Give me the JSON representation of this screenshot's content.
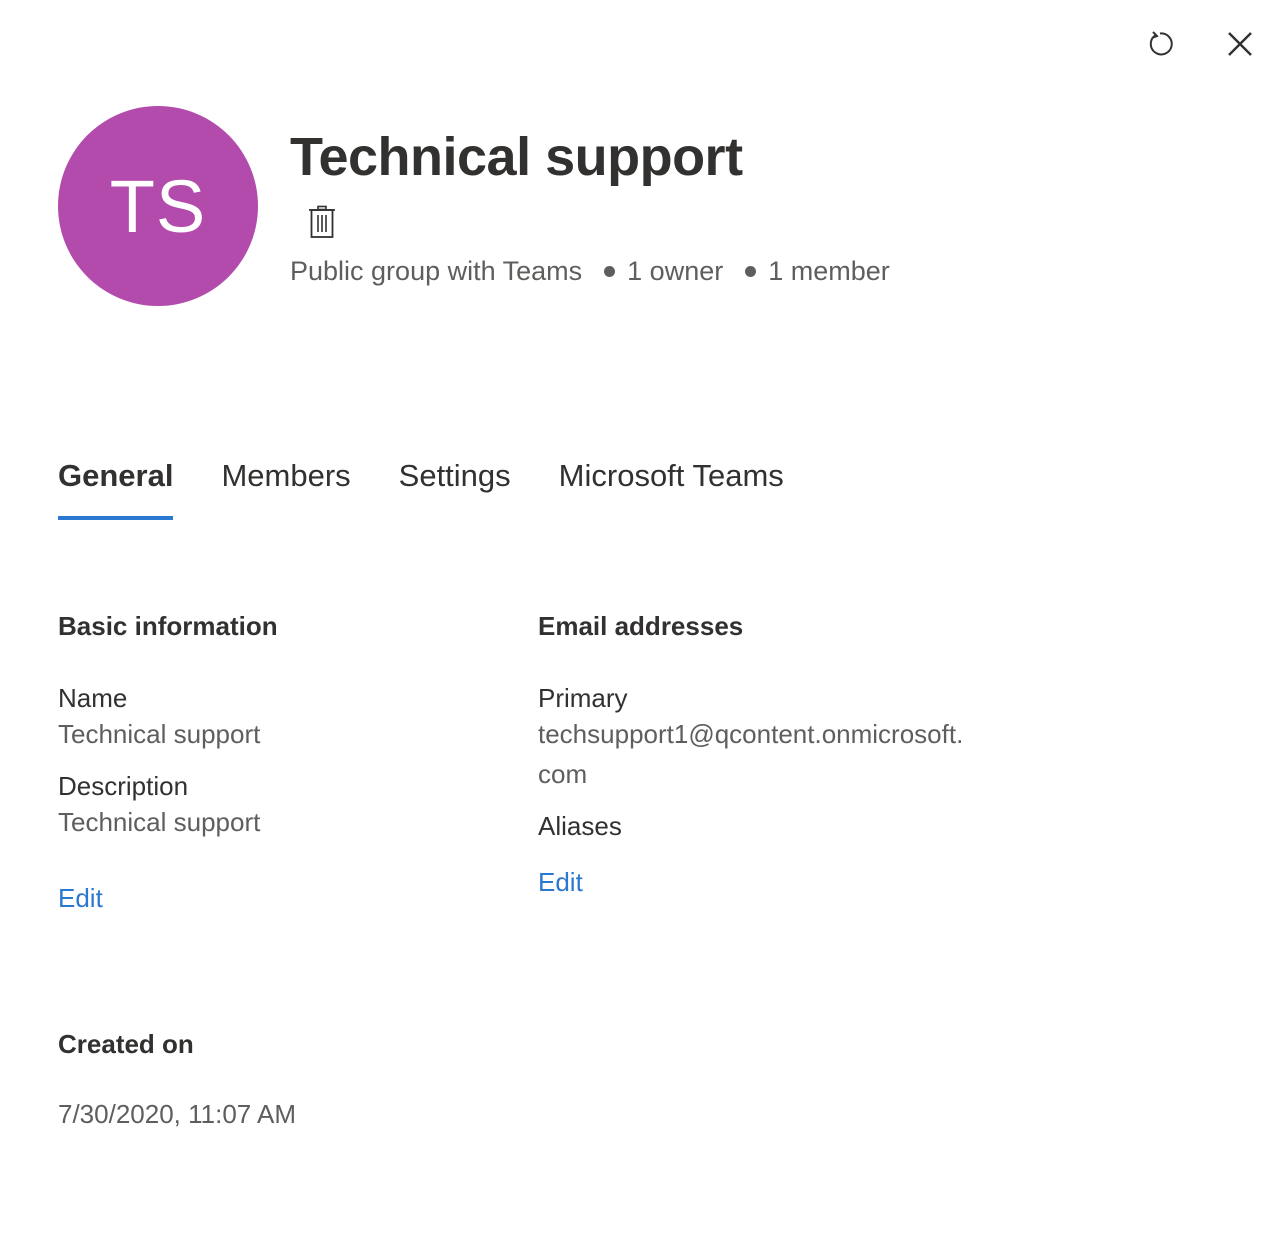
{
  "panel": {
    "refresh_label": "Refresh",
    "close_label": "Close"
  },
  "group": {
    "initials": "TS",
    "avatar_color": "#b34bac",
    "title": "Technical support",
    "delete_label": "Delete group",
    "type": "Public group with Teams",
    "owners": "1 owner",
    "members": "1 member"
  },
  "tabs": [
    {
      "label": "General",
      "active": true
    },
    {
      "label": "Members",
      "active": false
    },
    {
      "label": "Settings",
      "active": false
    },
    {
      "label": "Microsoft Teams",
      "active": false
    }
  ],
  "basic_info": {
    "title": "Basic information",
    "name_label": "Name",
    "name_value": "Technical support",
    "description_label": "Description",
    "description_value": "Technical support",
    "edit_label": "Edit"
  },
  "email": {
    "title": "Email addresses",
    "primary_label": "Primary",
    "primary_value": "techsupport1@qcontent.onmicrosoft.com",
    "aliases_label": "Aliases",
    "edit_label": "Edit"
  },
  "created": {
    "title": "Created on",
    "value": "7/30/2020, 11:07 AM"
  },
  "colors": {
    "accent": "#2b78d0",
    "text_primary": "#323130",
    "text_secondary": "#605e5c"
  }
}
